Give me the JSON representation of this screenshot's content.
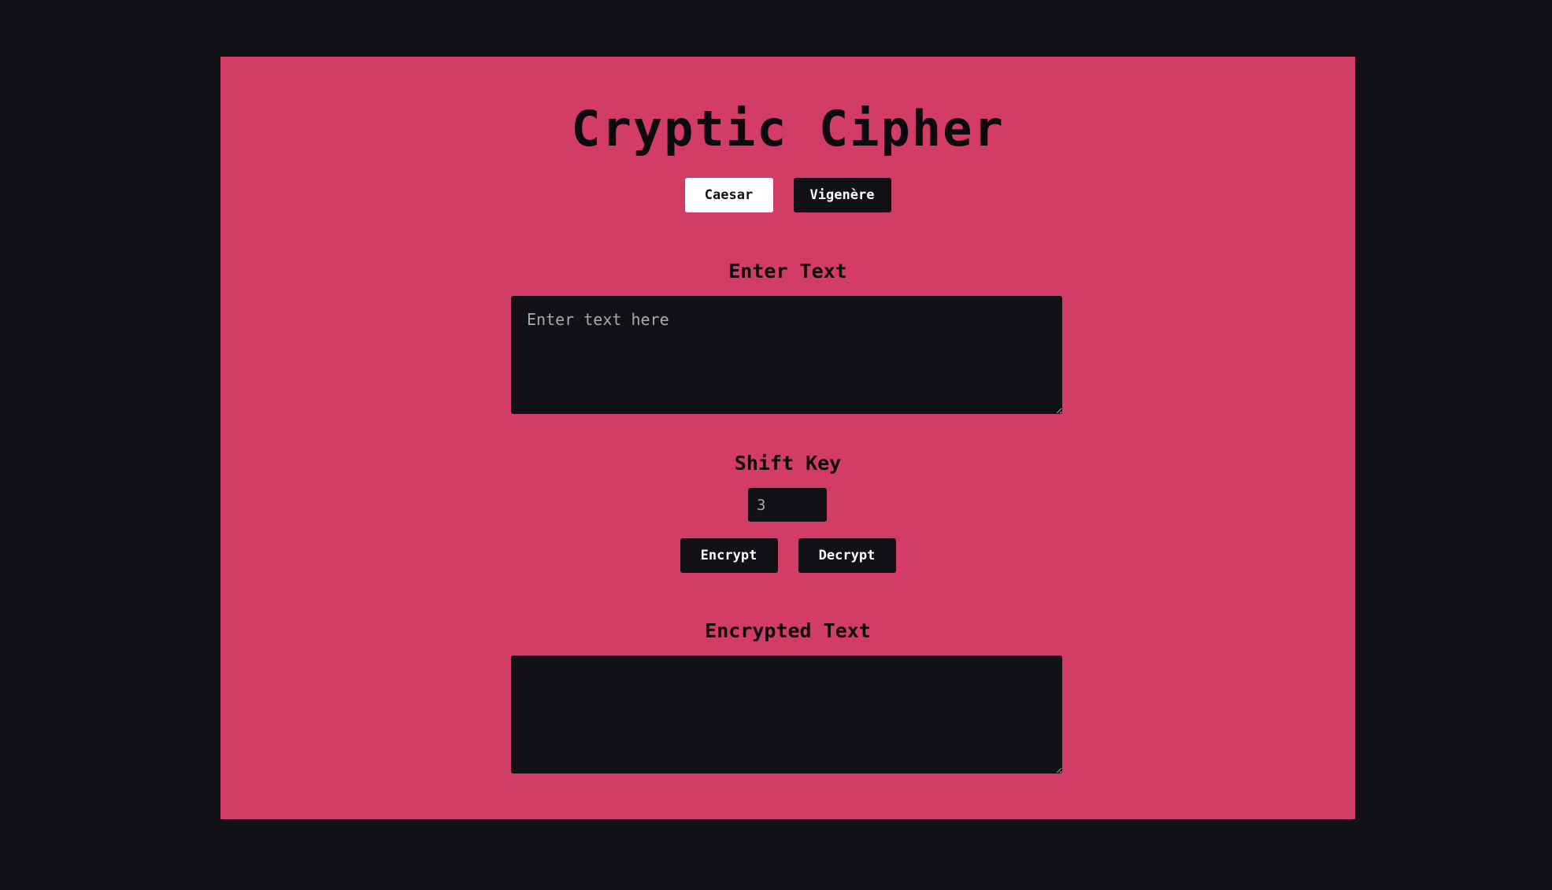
{
  "app": {
    "title": "Cryptic Cipher"
  },
  "modes": {
    "caesar_label": "Caesar",
    "vigenere_label": "Vigenère",
    "active": "Caesar"
  },
  "input": {
    "label": "Enter Text",
    "placeholder": "Enter text here",
    "value": ""
  },
  "shift": {
    "label": "Shift Key",
    "value": "3"
  },
  "actions": {
    "encrypt_label": "Encrypt",
    "decrypt_label": "Decrypt"
  },
  "output": {
    "label": "Encrypted Text",
    "value": ""
  },
  "colors": {
    "page_background": "#121117",
    "panel_background": "#d33c66",
    "field_background": "#121117",
    "active_button": "#ffffff"
  }
}
